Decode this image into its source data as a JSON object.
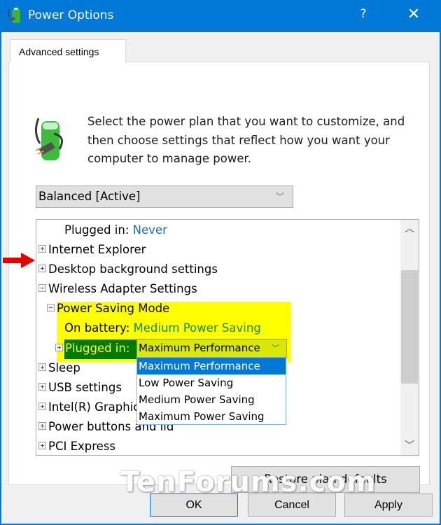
{
  "window": {
    "title": "Power Options",
    "help_label": "?",
    "close_label": "✕",
    "accent_color": "#0078d7"
  },
  "tab": {
    "label": "Advanced settings"
  },
  "description": "Select the power plan that you want to customize, and then choose settings that reflect how you want your computer to manage power.",
  "plan_select": {
    "value": "Balanced [Active]"
  },
  "tree": {
    "rows": [
      {
        "label": "Plugged in:",
        "value": "Never"
      },
      {
        "label": "Internet Explorer"
      },
      {
        "label": "Desktop background settings"
      },
      {
        "label": "Wireless Adapter Settings"
      },
      {
        "label": "Power Saving Mode"
      },
      {
        "label": "On battery:",
        "value": "Medium Power Saving"
      },
      {
        "label": "Plugged in:",
        "value": "Maximum Performance"
      },
      {
        "label": "Sleep"
      },
      {
        "label": "USB settings"
      },
      {
        "label": "Intel(R) Graphics Settings"
      },
      {
        "label": "Power buttons and lid"
      },
      {
        "label": "PCI Express"
      }
    ],
    "highlight_colors": {
      "yellow": "#ffff00",
      "green": "#007a00"
    }
  },
  "dropdown": {
    "options": [
      "Maximum Performance",
      "Low Power Saving",
      "Medium Power Saving",
      "Maximum Power Saving"
    ],
    "selected": "Maximum Performance"
  },
  "buttons": {
    "restore": "Restore plan defaults",
    "ok": "OK",
    "cancel": "Cancel",
    "apply": "Apply"
  },
  "watermark": "TenForums.com"
}
